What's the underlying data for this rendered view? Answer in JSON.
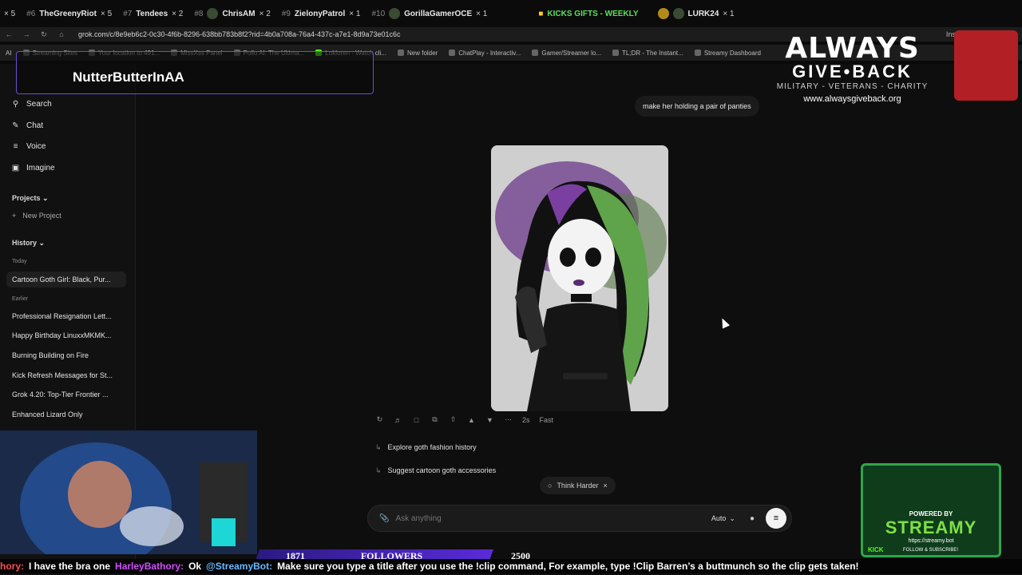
{
  "ticker": {
    "items": [
      {
        "rank": "",
        "name": "",
        "mult": "× 5"
      },
      {
        "rank": "#6",
        "name": "TheGreenyRiot",
        "mult": "× 5"
      },
      {
        "rank": "#7",
        "name": "Tendees",
        "mult": "× 2"
      },
      {
        "rank": "#8",
        "name": "ChrisAM",
        "mult": "× 2"
      },
      {
        "rank": "#9",
        "name": "ZielonyPatrol",
        "mult": "× 1"
      },
      {
        "rank": "#10",
        "name": "GorillaGamerOCE",
        "mult": "× 1"
      }
    ],
    "gifts_label": "KICKS GIFTS - WEEKLY",
    "lurk": {
      "name": "LURK24",
      "mult": "× 1"
    }
  },
  "browser": {
    "url": "grok.com/c/8e9eb6c2-0c30-4f6b-8296-638bb783b8f2?rid=4b0a708a-76a4-437c-a7e1-8d9a73e01c6c",
    "install_label": "Install",
    "bookmarks": [
      "AI",
      "Streaming Sites",
      "Your location to 491...",
      "MissXss Panel",
      "Pollo AI: The Ultima...",
      "Lokloren - Watch cli...",
      "New folder",
      "ChatPlay - Interactiv...",
      "Gamer/Streamer lo...",
      "TL;DR - The Instant...",
      "Streamy Dashboard"
    ]
  },
  "overlay": {
    "nameplate": "NutterButterInAA",
    "agb_line1": "ALWAYS",
    "agb_line2": "GIVE•BACK",
    "agb_tag": "MILITARY - VETERANS - CHARITY",
    "agb_web": "www.alwaysgiveback.org",
    "streamy_powered": "POWERED BY",
    "streamy_name": "STREAMY",
    "streamy_url": "https://streamy.bot",
    "kick": "KICK",
    "follow": "FOLLOW & SUBSCRIBE!",
    "followers_label": "FOLLOWERS",
    "followers_count": "1871",
    "followers_goal": "2500",
    "chat": {
      "user1": "hory:",
      "msg1": "I have the bra one",
      "user2": "HarleyBathory:",
      "msg2": "Ok",
      "user3": "@StreamyBot:",
      "msg3": "Make sure you type a title after you use the !clip command, For example, type !Clip Barren’s a buttmunch so the clip gets taken!"
    }
  },
  "sidebar": {
    "nav": [
      {
        "icon": "search-icon",
        "label": "Search"
      },
      {
        "icon": "chat-icon",
        "label": "Chat"
      },
      {
        "icon": "voice-icon",
        "label": "Voice"
      },
      {
        "icon": "imagine-icon",
        "label": "Imagine"
      }
    ],
    "projects_label": "Projects",
    "new_project_label": "New Project",
    "history_label": "History",
    "today_label": "Today",
    "today_items": [
      "Cartoon Goth Girl: Black, Pur..."
    ],
    "earlier_label": "Earlier",
    "earlier_items": [
      "Professional Resignation Lett...",
      "Happy Birthday LinuxxMKMK...",
      "Burning Building on Fire",
      "Kick Refresh Messages for St...",
      "Grok 4.20: Top-Tier Frontier ...",
      "Enhanced Lizard Only"
    ]
  },
  "chat": {
    "user_message": "make her holding a pair of panties",
    "response_time": "2s",
    "response_mode": "Fast",
    "suggestions": [
      "Explore goth fashion history",
      "Suggest cartoon goth accessories"
    ],
    "think_harder": "Think Harder",
    "composer_placeholder": "Ask anything",
    "model_mode": "Auto"
  }
}
